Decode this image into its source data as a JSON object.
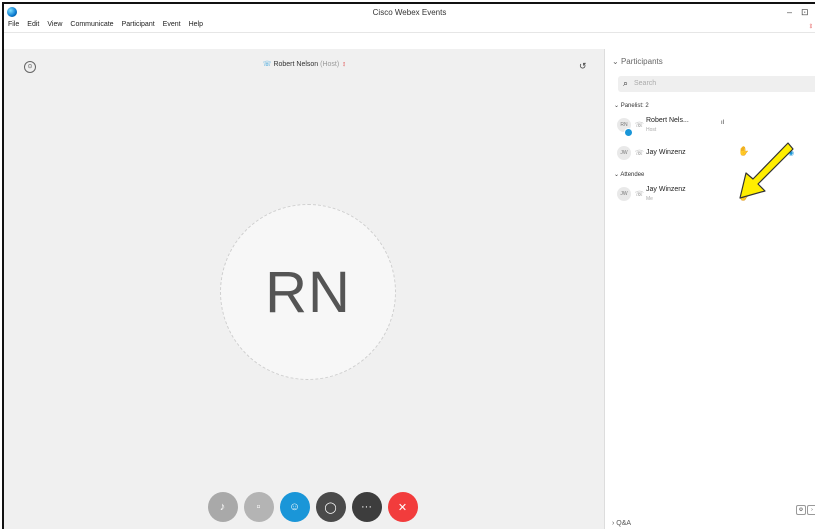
{
  "window": {
    "title": "Cisco Webex Events",
    "minimize": "–",
    "restore": "⊡"
  },
  "menu": {
    "items": [
      "File",
      "Edit",
      "View",
      "Communicate",
      "Participant",
      "Event",
      "Help"
    ]
  },
  "stage": {
    "speaker_name": "Robert Nelson",
    "speaker_role": "(Host)",
    "avatar_initials": "RN"
  },
  "panel": {
    "title": "Participants",
    "search_placeholder": "Search",
    "panelist_header": "Panelist: 2",
    "attendee_header": "Attendee",
    "panelists": [
      {
        "initials": "RN",
        "name": "Robert Nels...",
        "role": "Host"
      },
      {
        "initials": "JW",
        "name": "Jay Winzenz",
        "role": ""
      }
    ],
    "attendees": [
      {
        "initials": "JW",
        "name": "Jay Winzenz",
        "role": "Me"
      }
    ],
    "qa_label": "Q&A"
  },
  "colors": {
    "accent": "#1a96d8",
    "leave": "#f23c3c",
    "arrow": "#ffee00"
  }
}
